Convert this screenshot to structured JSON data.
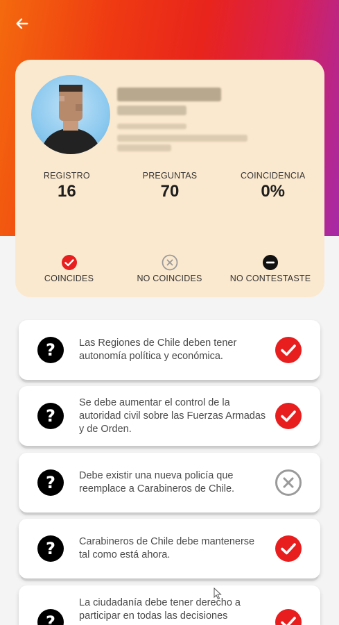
{
  "header": {
    "back_icon": "arrow-left-icon"
  },
  "profile": {
    "stats": [
      {
        "label": "REGISTRO",
        "value": "16"
      },
      {
        "label": "PREGUNTAS",
        "value": "70"
      },
      {
        "label": "COINCIDENCIA",
        "value": "0%"
      }
    ],
    "legend": [
      {
        "label": "COINCIDES",
        "icon": "check-circle-icon"
      },
      {
        "label": "NO COINCIDES",
        "icon": "x-circle-icon"
      },
      {
        "label": "NO CONTESTASTE",
        "icon": "minus-circle-icon"
      }
    ]
  },
  "questions": [
    {
      "text": "Las Regiones de Chile deben tener autonomía política y económica.",
      "status": "match"
    },
    {
      "text": "Se debe aumentar el control de la autoridad civil sobre las Fuerzas Armadas y de Orden.",
      "status": "match"
    },
    {
      "text": "Debe existir una nueva policía que reemplace a Carabineros de Chile.",
      "status": "no-match"
    },
    {
      "text": "Carabineros de Chile debe mantenerse tal como está ahora.",
      "status": "match"
    },
    {
      "text": "La ciudadanía debe tener derecho a participar en todas las decisiones",
      "status": "match"
    }
  ],
  "colors": {
    "accent_red": "#e81e1e",
    "card_cream": "#fbe9cf",
    "muted_gray": "#9a9a9a"
  }
}
